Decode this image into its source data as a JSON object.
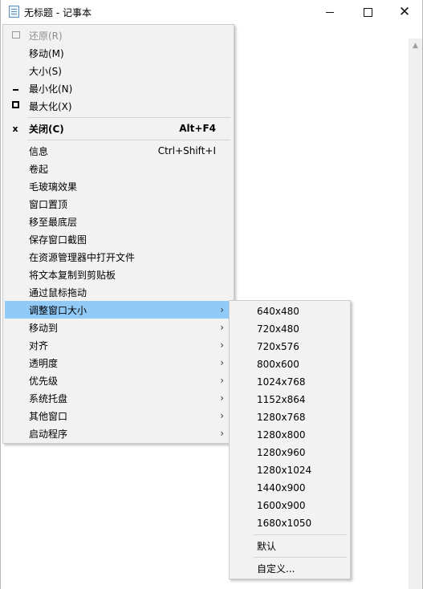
{
  "window": {
    "title": "无标题 - 记事本",
    "controls": {
      "minimize": "minimize-icon",
      "maximize": "maximize-icon",
      "close": "close-icon"
    }
  },
  "menu": {
    "group1": [
      {
        "label": "还原(R)",
        "icon": "restore-icon",
        "disabled": true
      },
      {
        "label": "移动(M)",
        "icon": ""
      },
      {
        "label": "大小(S)",
        "icon": ""
      },
      {
        "label": "最小化(N)",
        "icon": "minimize-icon"
      },
      {
        "label": "最大化(X)",
        "icon": "maximize-icon"
      }
    ],
    "close": {
      "label": "关闭(C)",
      "shortcut": "Alt+F4",
      "icon": "x"
    },
    "group3": [
      {
        "label": "信息",
        "shortcut": "Ctrl+Shift+I"
      },
      {
        "label": "卷起"
      },
      {
        "label": "毛玻璃效果"
      },
      {
        "label": "窗口置顶"
      },
      {
        "label": "移至最底层"
      },
      {
        "label": "保存窗口截图"
      },
      {
        "label": "在资源管理器中打开文件"
      },
      {
        "label": "将文本复制到剪贴板"
      },
      {
        "label": "通过鼠标拖动"
      }
    ],
    "submenus": [
      {
        "label": "调整窗口大小",
        "arrow": "›",
        "highlighted": true
      },
      {
        "label": "移动到",
        "arrow": "›"
      },
      {
        "label": "对齐",
        "arrow": "›"
      },
      {
        "label": "透明度",
        "arrow": "›"
      },
      {
        "label": "优先级",
        "arrow": "›"
      },
      {
        "label": "系统托盘",
        "arrow": "›"
      },
      {
        "label": "其他窗口",
        "arrow": "›"
      },
      {
        "label": "启动程序",
        "arrow": "›"
      }
    ]
  },
  "resize_submenu": {
    "sizes": [
      "640x480",
      "720x480",
      "720x576",
      "800x600",
      "1024x768",
      "1152x864",
      "1280x768",
      "1280x800",
      "1280x960",
      "1280x1024",
      "1440x900",
      "1600x900",
      "1680x1050"
    ],
    "default": "默认",
    "custom": "自定义..."
  }
}
